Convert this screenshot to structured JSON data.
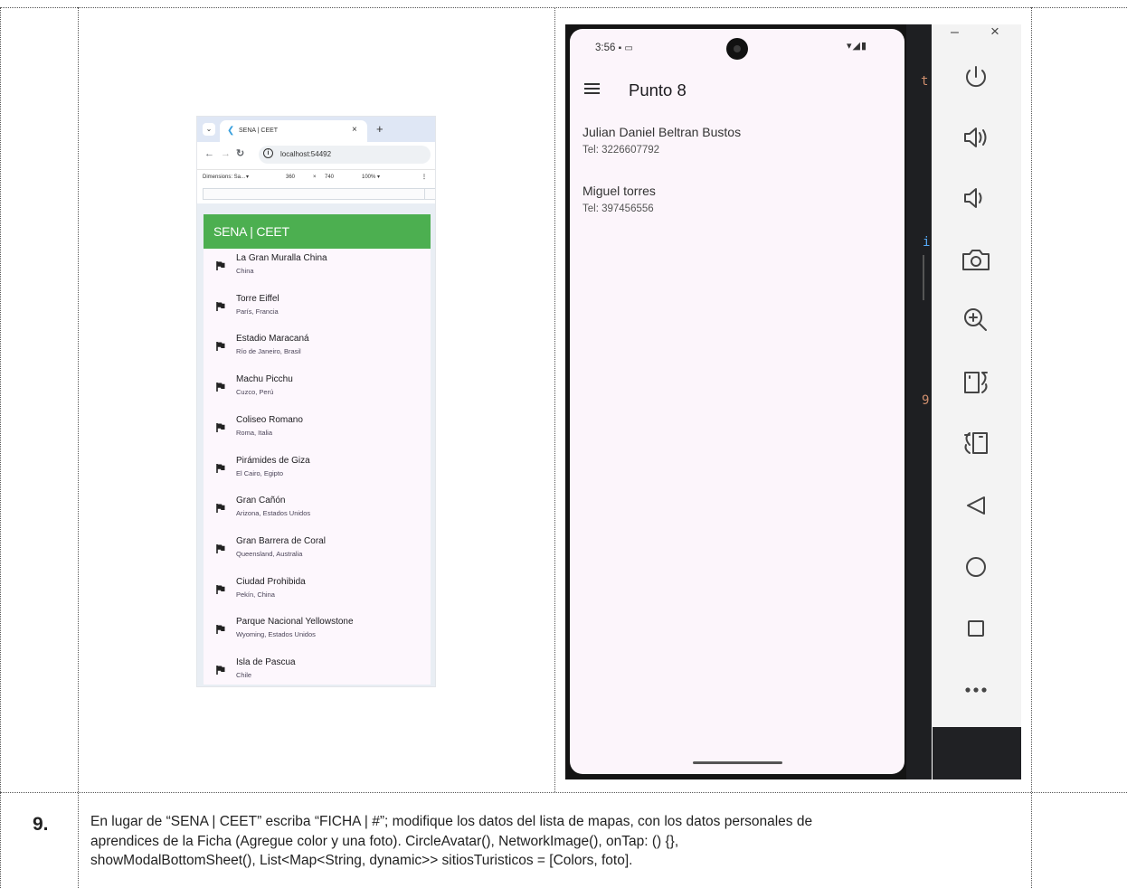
{
  "browser": {
    "tab_title": "SENA | CEET",
    "tab_close": "×",
    "new_tab": "+",
    "url": "localhost:54492",
    "device_label": "Dimensions: Sa...",
    "device_width": "360",
    "device_times": "×",
    "device_height": "740",
    "device_zoom": "100% ▾",
    "app_title": "SENA | CEET",
    "sites": [
      {
        "name": "La Gran Muralla China",
        "location": "China"
      },
      {
        "name": "Torre Eiffel",
        "location": "París, Francia"
      },
      {
        "name": "Estadio Maracaná",
        "location": "Río de Janeiro, Brasil"
      },
      {
        "name": "Machu Picchu",
        "location": "Cuzco, Perú"
      },
      {
        "name": "Coliseo Romano",
        "location": "Roma, Italia"
      },
      {
        "name": "Pirámides de Giza",
        "location": "El Cairo, Egipto"
      },
      {
        "name": "Gran Cañón",
        "location": "Arizona, Estados Unidos"
      },
      {
        "name": "Gran Barrera de Coral",
        "location": "Queensland, Australia"
      },
      {
        "name": "Ciudad Prohibida",
        "location": "Pekín, China"
      },
      {
        "name": "Parque Nacional Yellowstone",
        "location": "Wyoming, Estados Unidos"
      },
      {
        "name": "Isla de Pascua",
        "location": "Chile"
      }
    ]
  },
  "phone": {
    "status_time": "3:56",
    "title": "Punto 8",
    "contacts": [
      {
        "name": "Julian Daniel Beltran Bustos",
        "phone": "Tel: 3226607792"
      },
      {
        "name": "Miguel torres",
        "phone": "Tel: 397456556"
      }
    ]
  },
  "emulator": {
    "minimize": "–",
    "close": "×",
    "icons": [
      "power-icon",
      "volume-up-icon",
      "volume-down-icon",
      "camera-icon",
      "zoom-in-icon",
      "rotate-right-icon",
      "rotate-left-icon",
      "back-icon",
      "home-icon",
      "overview-icon",
      "more-icon"
    ]
  },
  "row": {
    "number": "9.",
    "text": "En lugar de “SENA | CEET” escriba “FICHA | #”; modifique los datos del lista de mapas, con los datos personales de\naprendices de la Ficha (Agregue color y una foto). CircleAvatar(), NetworkImage(), onTap: () {},\nshowModalBottomSheet(),  List<Map<String, dynamic>> sitiosTuristicos = [Colors, foto]."
  }
}
